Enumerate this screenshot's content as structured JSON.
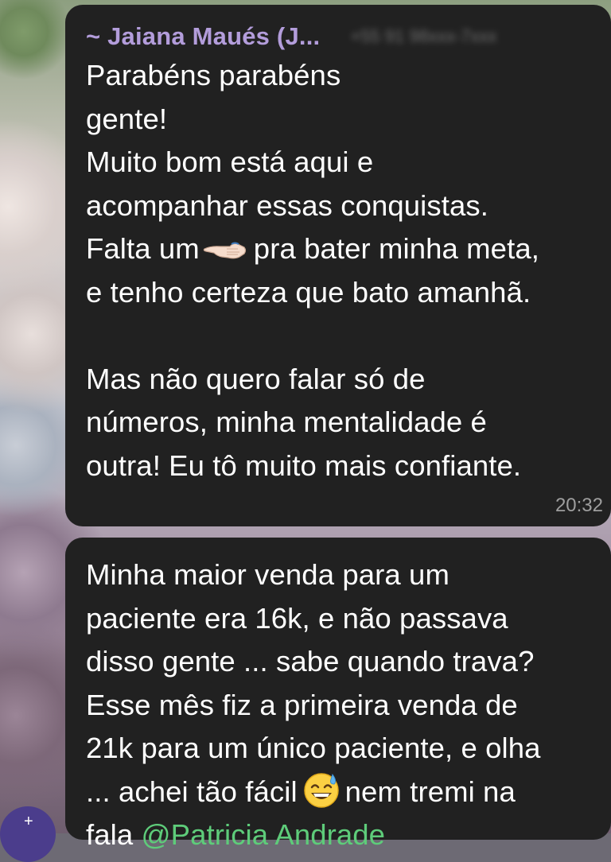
{
  "message_1": {
    "sender_name": "~ Jaiana Maués (J...",
    "sender_phone": "+55 91 98xxx-7xxx",
    "lines": [
      "Parabéns parabéns",
      "gente!",
      "Muito bom está aqui e",
      "acompanhar essas conquistas.",
      "Falta um",
      "pra bater minha meta,",
      "e tenho certeza que bato amanhã.",
      "",
      "Mas não quero falar só de",
      "números, minha mentalidade é",
      "outra! Eu tô muito mais confiante."
    ],
    "line1_tail": "parabéns",
    "emoji_1": "backhand-index-pointing-left",
    "time": "20:32"
  },
  "message_2": {
    "lines": [
      "Minha maior venda para um",
      "paciente era 16k, e não passava",
      "disso gente ... sabe quando trava?",
      "Esse mês fiz a primeira venda de",
      "21k para um único paciente, e olha",
      "... achei tão fácil",
      "nem tremi na",
      "fala "
    ],
    "emoji_2": "grinning-face-with-sweat",
    "mention": "@Patricia Andrade"
  },
  "colors": {
    "bubble_bg": "#212121",
    "sender_name": "#b39ddb",
    "mention": "#5ecc7a",
    "time": "#9e9e9e"
  }
}
